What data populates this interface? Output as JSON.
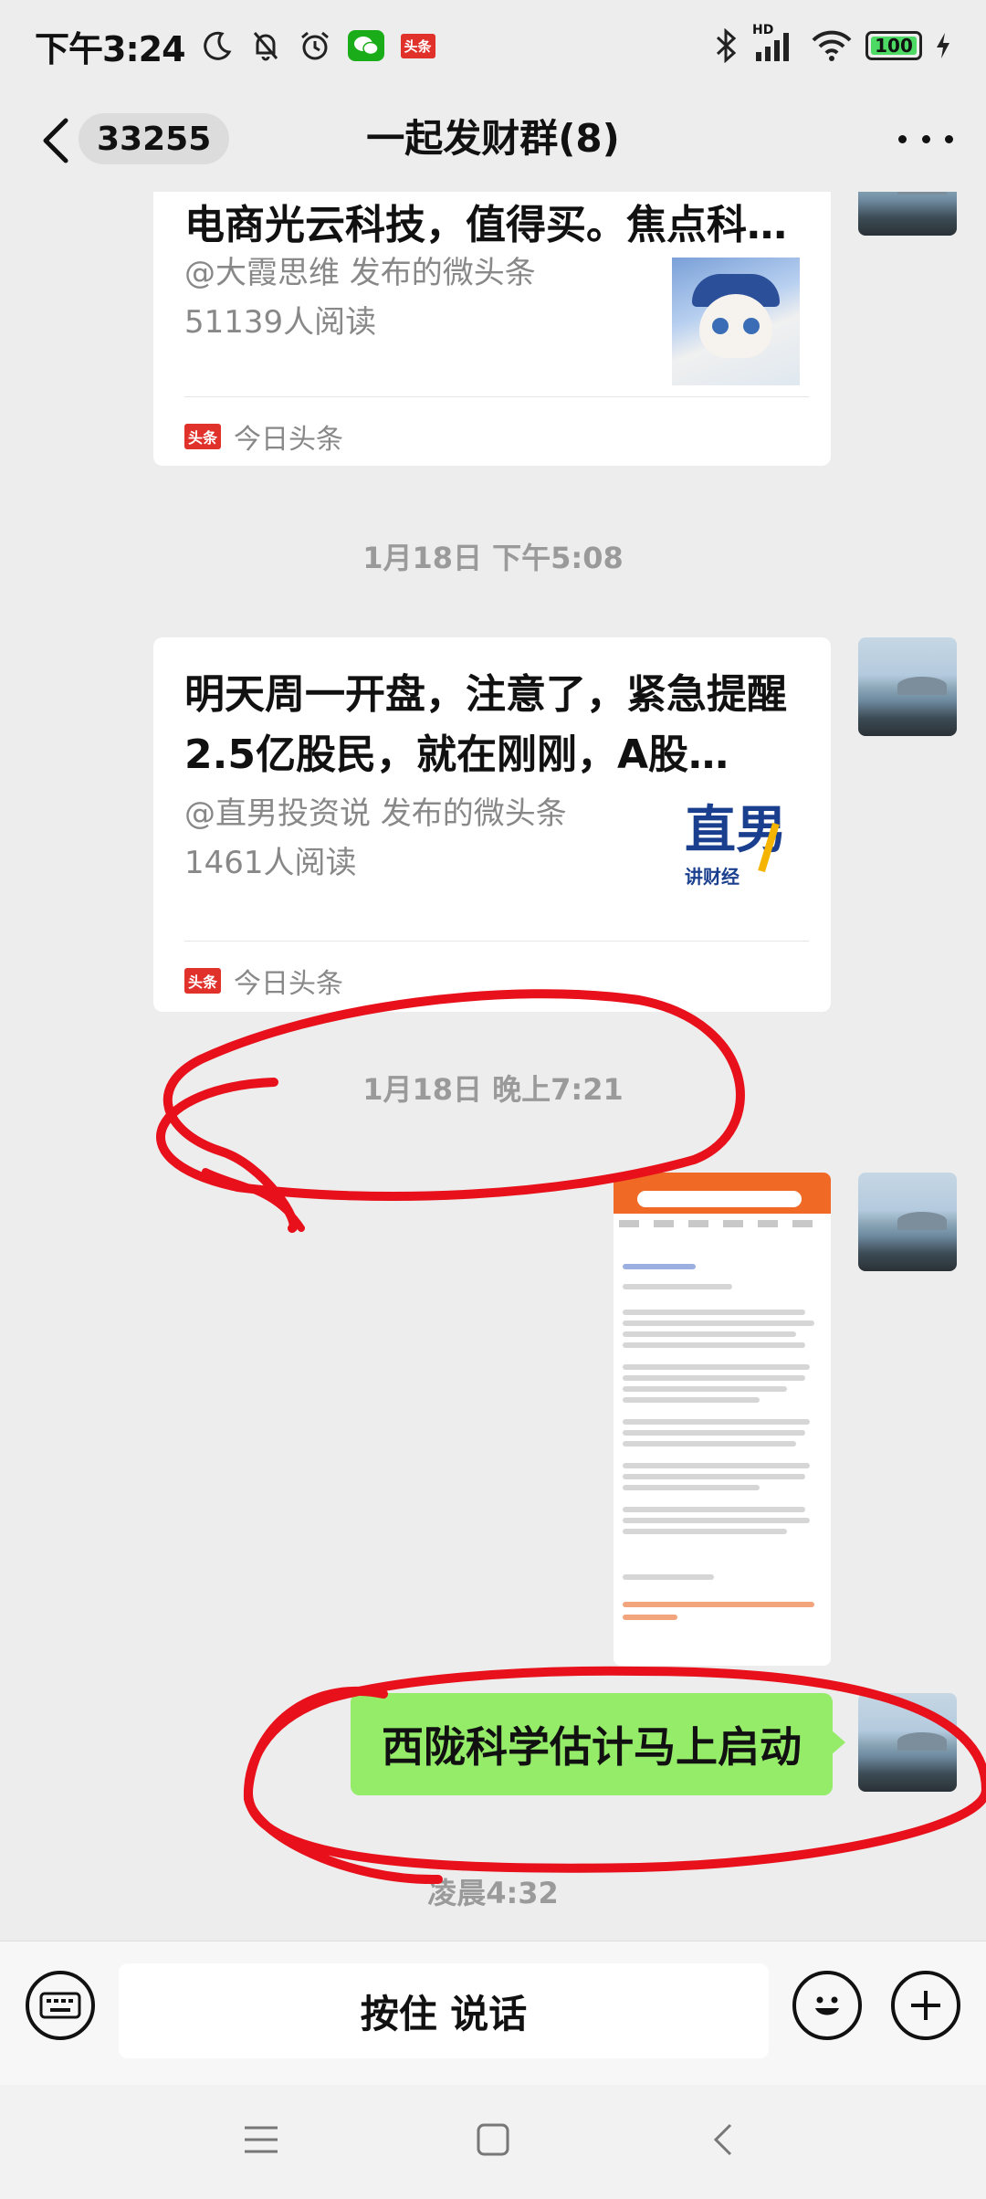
{
  "status_bar": {
    "time": "下午3:24",
    "toutiao_badge": "头条",
    "network": "HD",
    "battery": "100"
  },
  "header": {
    "unread_count": "33255",
    "title": "一起发财群(8)"
  },
  "messages": {
    "card1": {
      "headline": "电商光云科技，值得买。焦点科…",
      "author": "@大霞思维 发布的微头条",
      "reads": "51139人阅读",
      "source": "今日头条",
      "source_badge": "头条"
    },
    "time1": "1月18日 下午5:08",
    "card2": {
      "headline": "明天周一开盘，注意了，紧急提醒2.5亿股民，就在刚刚，A股…",
      "author": "@直男投资说 发布的微头条",
      "reads": "1461人阅读",
      "source": "今日头条",
      "source_badge": "头条",
      "logo_big": "直男",
      "logo_small": "讲财经"
    },
    "time2": "1月18日 晚上7:21",
    "text_bubble": "西陇科学估计马上启动",
    "time3": "凌晨4:32"
  },
  "input_bar": {
    "hold_to_talk": "按住 说话"
  },
  "colors": {
    "bubble_green": "#95ec69",
    "annotation_red": "#e8101a",
    "toutiao_red": "#e0312b",
    "background": "#ededed"
  }
}
